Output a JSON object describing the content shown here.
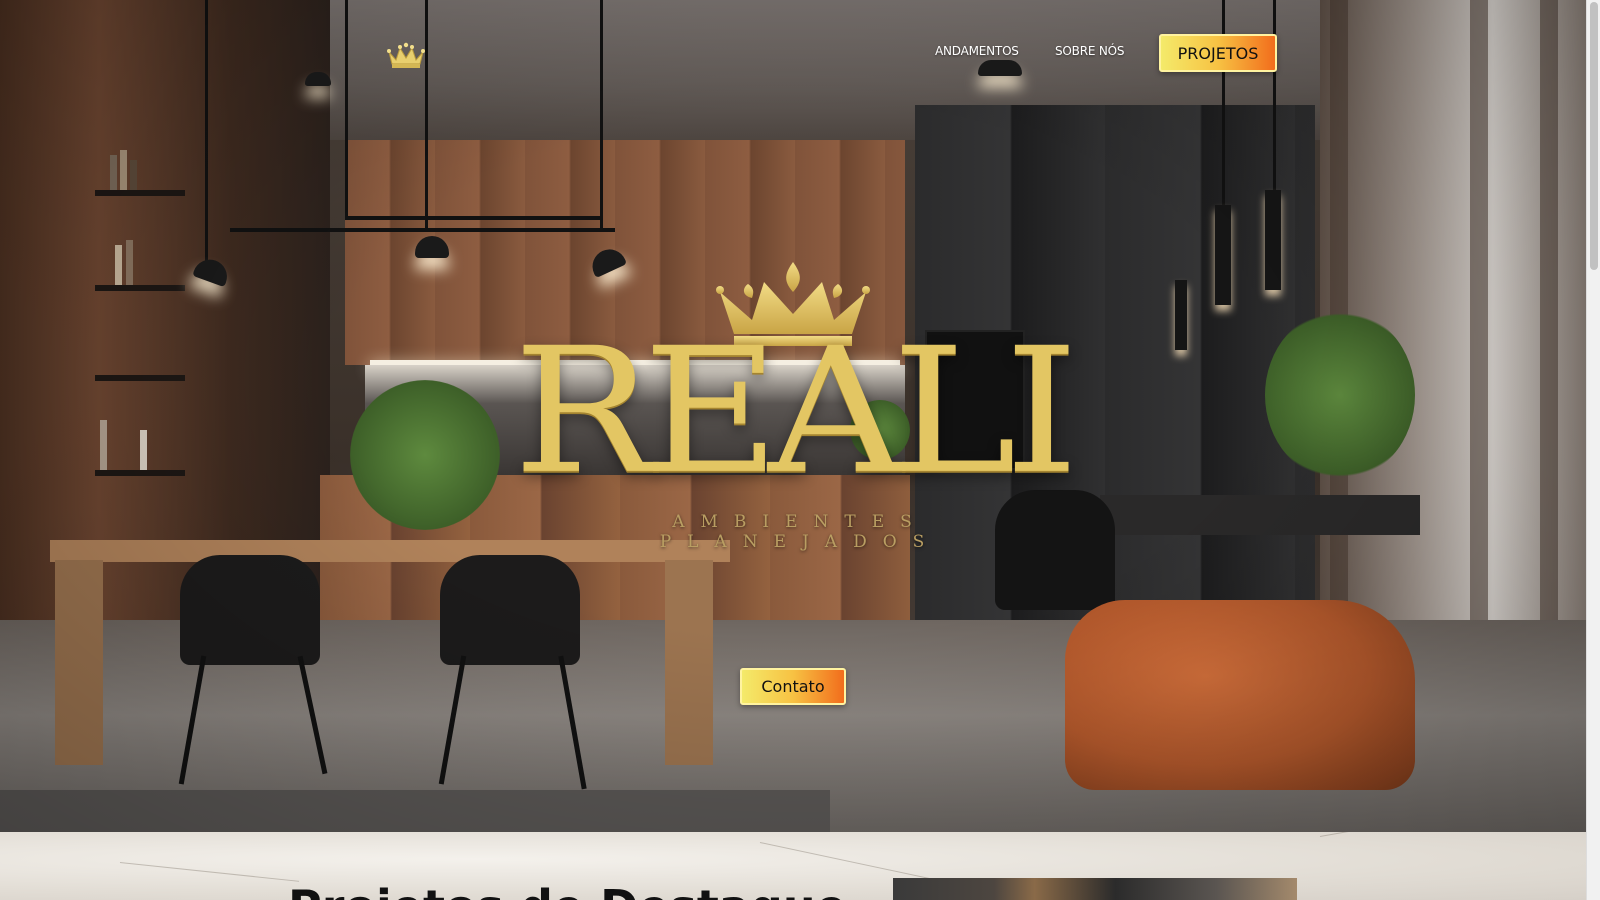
{
  "nav": {
    "logo_icon": "crown-icon",
    "links": [
      {
        "label": "ANDAMENTOS"
      },
      {
        "label": "SOBRE NÓS"
      }
    ],
    "cta_label": "PROJETOS"
  },
  "hero": {
    "brand_word": "REALI",
    "brand_tagline": "AMBIENTES PLANEJADOS",
    "brand_icon": "crown-icon",
    "contact_label": "Contato"
  },
  "section": {
    "title": "Projetos de Destaque"
  },
  "colors": {
    "gold": "#e3c663",
    "button_gradient_start": "#f4ea6a",
    "button_gradient_end": "#f26d1c"
  }
}
